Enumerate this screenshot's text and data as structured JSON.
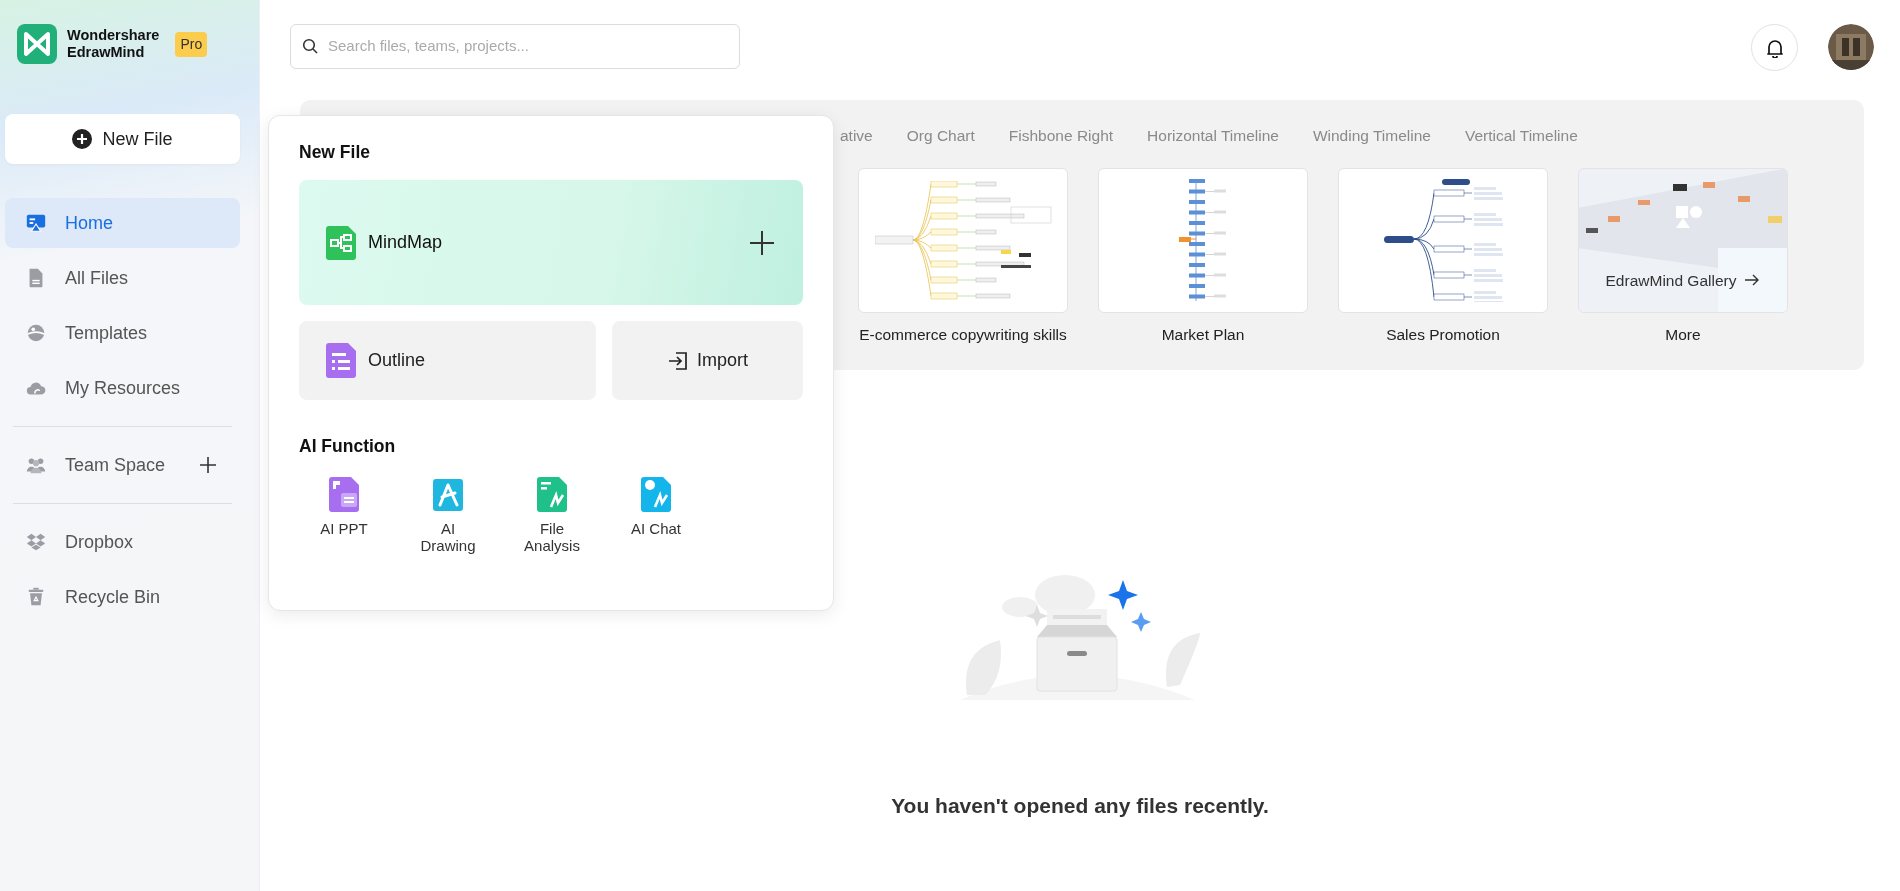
{
  "brand": {
    "lines": [
      "Wondershare",
      "EdrawMind"
    ],
    "plan_badge": "Pro"
  },
  "new_file_button": {
    "label": "New File"
  },
  "nav_groups": [
    [
      {
        "label": "Home",
        "selected": true
      },
      {
        "label": "All Files",
        "selected": false
      },
      {
        "label": "Templates",
        "selected": false
      },
      {
        "label": "My Resources",
        "selected": false
      }
    ],
    [
      {
        "label": "Team Space",
        "selected": false,
        "has_add": true
      }
    ],
    [
      {
        "label": "Dropbox",
        "selected": false
      },
      {
        "label": "Recycle Bin",
        "selected": false
      }
    ]
  ],
  "search": {
    "placeholder": "Search files, teams, projects..."
  },
  "template_tabs": [
    {
      "label": "ative"
    },
    {
      "label": "Org Chart"
    },
    {
      "label": "Fishbone Right"
    },
    {
      "label": "Horizontal Timeline"
    },
    {
      "label": "Winding Timeline"
    },
    {
      "label": "Vertical Timeline"
    }
  ],
  "templates": [
    {
      "title": "E-commerce copywriting skills",
      "kind": "mindmap"
    },
    {
      "title": "Market Plan",
      "kind": "vertical"
    },
    {
      "title": "Sales Promotion",
      "kind": "tree"
    },
    {
      "title": "More",
      "kind": "gallery",
      "caption": "EdrawMind Gallery"
    }
  ],
  "empty_state": {
    "message": "You haven't opened any files recently."
  },
  "new_file_menu": {
    "title": "New File",
    "primary": {
      "label": "MindMap"
    },
    "options": [
      {
        "label": "Outline",
        "kind": "outline"
      },
      {
        "label": "Import",
        "kind": "import"
      }
    ],
    "ai_title": "AI Function",
    "ai_items": [
      {
        "label": "AI PPT",
        "kind": "ppt"
      },
      {
        "label": "AI Drawing",
        "kind": "drawing"
      },
      {
        "label": "File Analysis",
        "kind": "analysis"
      },
      {
        "label": "AI Chat",
        "kind": "chat"
      }
    ]
  }
}
